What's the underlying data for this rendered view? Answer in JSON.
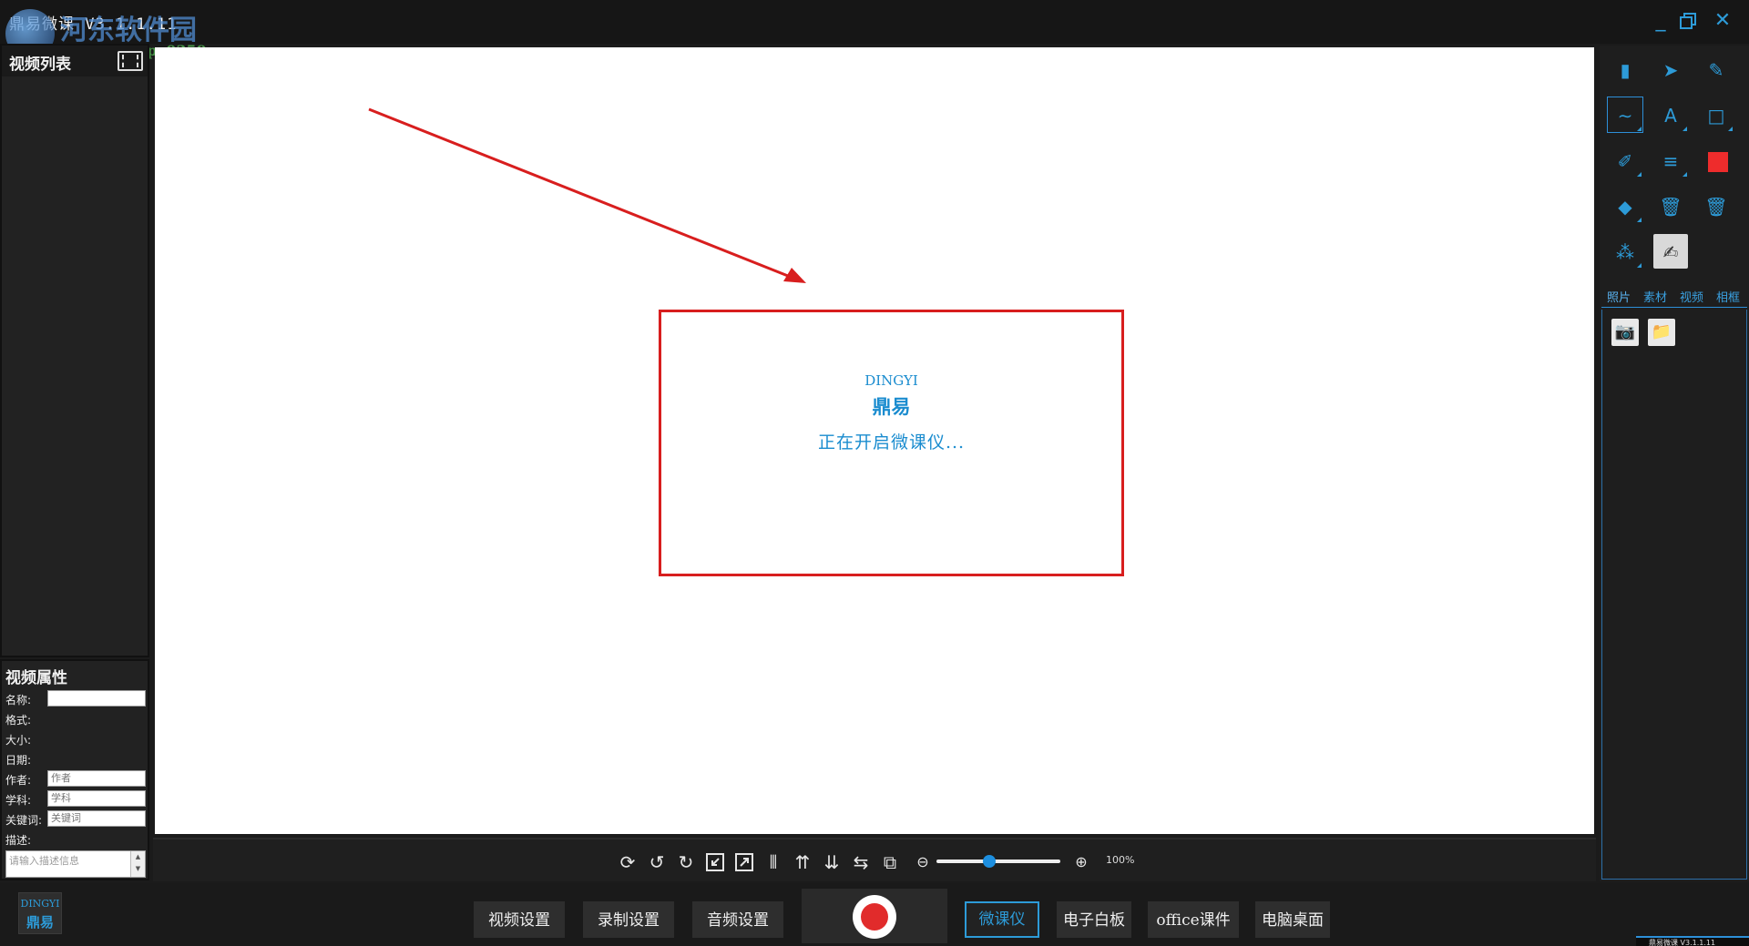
{
  "window": {
    "title": "鼎易微课 V3.1.1.11",
    "watermark_name": "河东软件园",
    "watermark_url": "www.pc0359.cn"
  },
  "video_list": {
    "title": "视频列表"
  },
  "properties": {
    "title": "视频属性",
    "name_label": "名称:",
    "format_label": "格式:",
    "size_label": "大小:",
    "date_label": "日期:",
    "author_label": "作者:",
    "author_placeholder": "作者",
    "subject_label": "学科:",
    "subject_placeholder": "学科",
    "keywords_label": "关键词:",
    "keywords_placeholder": "关键词",
    "desc_label": "描述:",
    "desc_placeholder": "请输入描述信息"
  },
  "canvas": {
    "brand_en": "DINGYI",
    "brand_cn": "鼎易",
    "loading_text": "正在开启微课仪..."
  },
  "canvas_toolbar": {
    "zoom_level": 0.43,
    "zoom_pct": "100%"
  },
  "right_panel": {
    "tabs": [
      "照片",
      "素材",
      "视频",
      "相框"
    ],
    "pen_color": "#ee2c2c"
  },
  "bottom": {
    "logo_en": "DINGYI",
    "logo_cn": "鼎易",
    "video_settings": "视频设置",
    "record_settings": "录制设置",
    "audio_settings": "音频设置",
    "microlesson": "微课仪",
    "whiteboard": "电子白板",
    "office": "office课件",
    "desktop": "电脑桌面",
    "tray_title": "鼎易微课 V3.1.1.11"
  }
}
